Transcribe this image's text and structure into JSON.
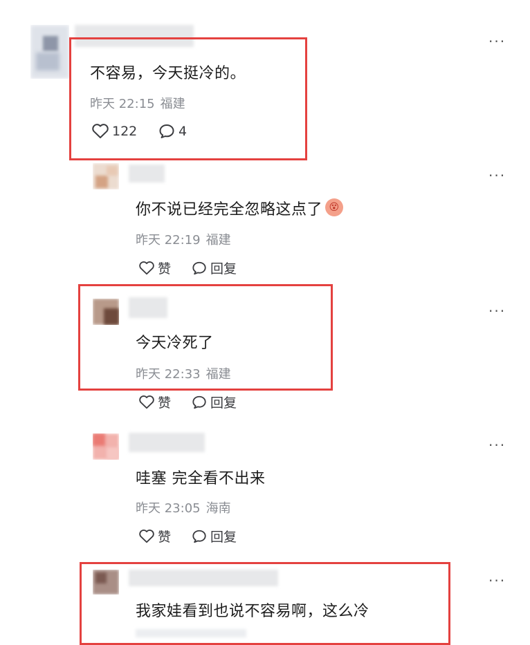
{
  "more_label": "···",
  "comments": [
    {
      "text": "不容易，今天挺冷的。",
      "time": "昨天 22:15",
      "location": "福建",
      "like_count": "122",
      "reply_count": "4"
    },
    {
      "text": "你不说已经完全忽略这点了",
      "emoji": "😵",
      "time": "昨天 22:19",
      "location": "福建",
      "like_label": "赞",
      "reply_label": "回复"
    },
    {
      "text": "今天冷死了",
      "time": "昨天 22:33",
      "location": "福建",
      "like_label": "赞",
      "reply_label": "回复"
    },
    {
      "text": "哇塞 完全看不出来",
      "time": "昨天 23:05",
      "location": "海南",
      "like_label": "赞",
      "reply_label": "回复"
    },
    {
      "text": "我家娃看到也说不容易啊，这么冷"
    }
  ],
  "colors": {
    "highlight": "#e4413f",
    "meta": "#8a8d93"
  }
}
